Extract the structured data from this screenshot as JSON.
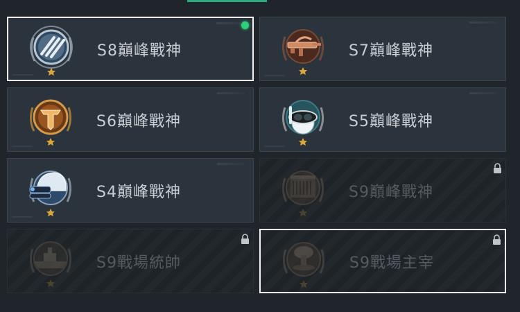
{
  "cards": [
    {
      "id": "s8",
      "title": "S8巔峰戰神",
      "locked": false,
      "selected": true,
      "active": true,
      "icon": "claw-slash-icon",
      "color": "#8fa9bf"
    },
    {
      "id": "s7",
      "title": "S7巔峰戰神",
      "locked": false,
      "selected": false,
      "active": false,
      "icon": "rifle-icon",
      "color": "#c07a58"
    },
    {
      "id": "s6",
      "title": "S6巔峰戰神",
      "locked": false,
      "selected": false,
      "active": false,
      "icon": "t-emblem-icon",
      "color": "#c77a2c"
    },
    {
      "id": "s5",
      "title": "S5巔峰戰神",
      "locked": false,
      "selected": false,
      "active": false,
      "icon": "diving-mask-icon",
      "color": "#3a6f78"
    },
    {
      "id": "s4",
      "title": "S4巔峰戰神",
      "locked": false,
      "selected": false,
      "active": false,
      "icon": "night-vision-helmet-icon",
      "color": "#4f6f94"
    },
    {
      "id": "s9-peak",
      "title": "S9巔峰戰神",
      "locked": true,
      "selected": false,
      "active": false,
      "icon": "fortress-icon",
      "color": "#5b544a"
    },
    {
      "id": "s9-commander",
      "title": "S9戰場統帥",
      "locked": true,
      "selected": false,
      "active": false,
      "icon": "warship-icon",
      "color": "#4f4d47"
    },
    {
      "id": "s9-ruler",
      "title": "S9戰場主宰",
      "locked": true,
      "selected": true,
      "active": false,
      "icon": "mushroom-cloud-icon",
      "color": "#5a5248"
    }
  ]
}
